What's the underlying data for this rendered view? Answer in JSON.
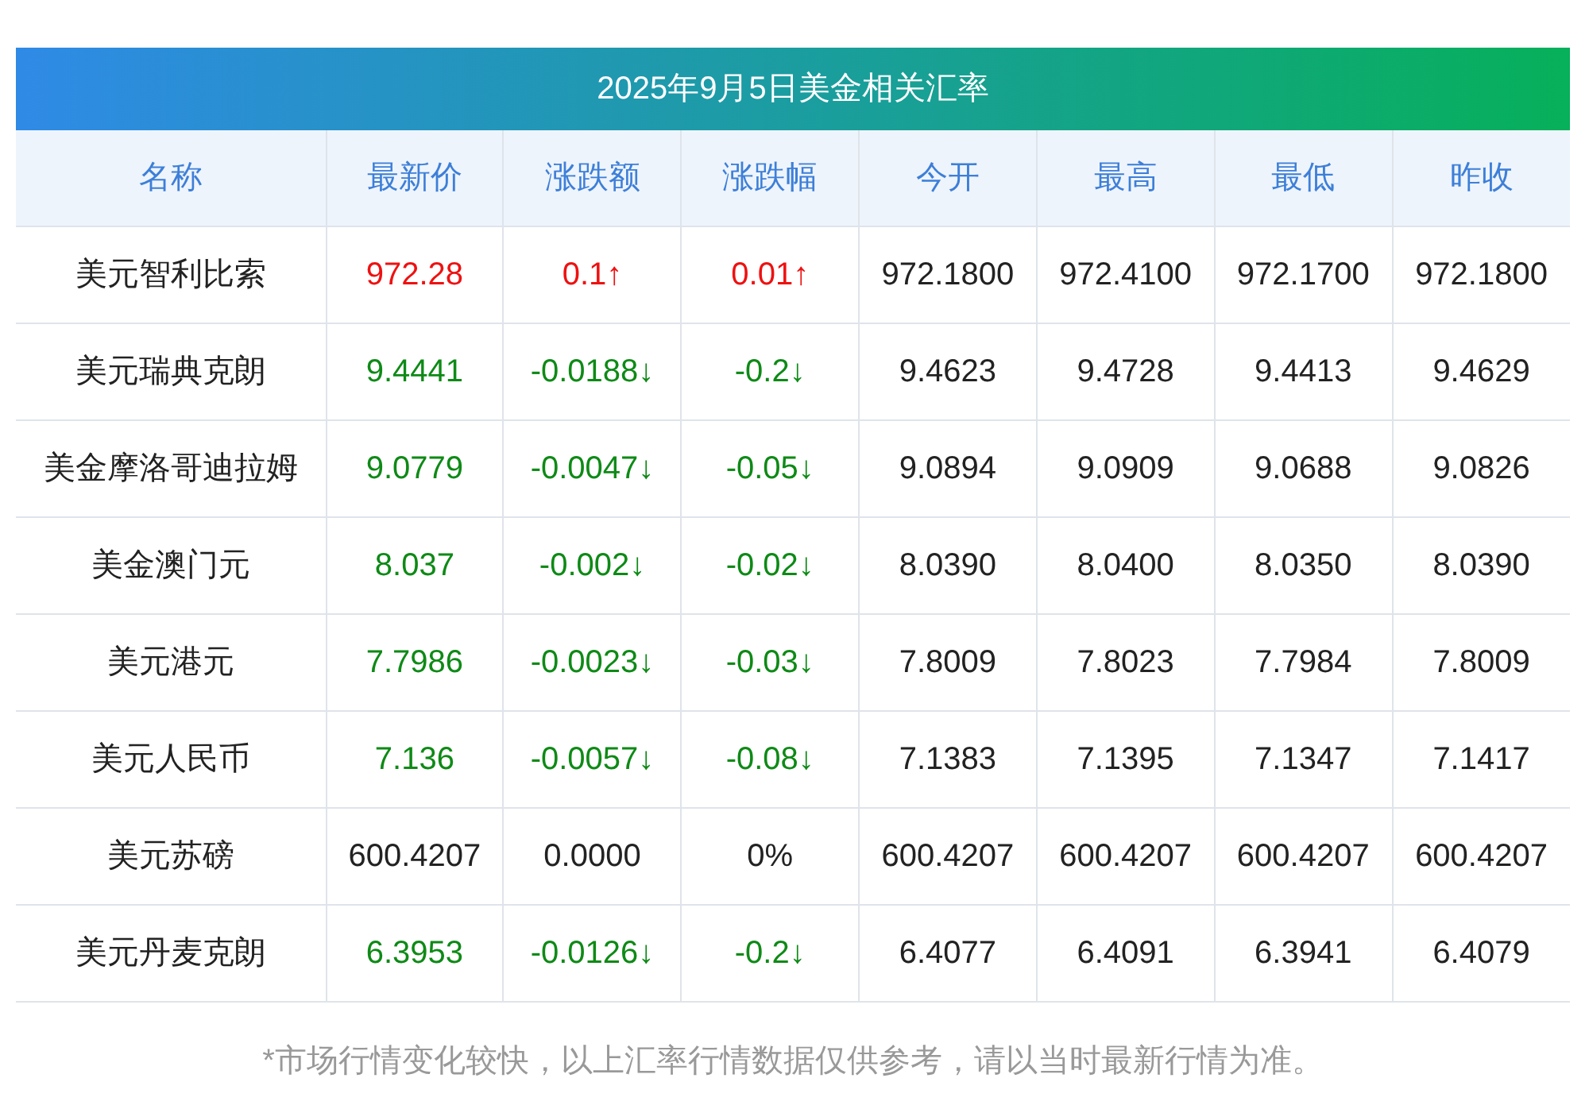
{
  "title": "2025年9月5日美金相关汇率",
  "columns": [
    "名称",
    "最新价",
    "涨跌额",
    "涨跌幅",
    "今开",
    "最高",
    "最低",
    "昨收"
  ],
  "rows": [
    {
      "name": "美元智利比索",
      "kind": "up",
      "latest": "972.28",
      "change": "0.1↑",
      "change_pct": "0.01↑",
      "open": "972.1800",
      "high": "972.4100",
      "low": "972.1700",
      "prev_close": "972.1800"
    },
    {
      "name": "美元瑞典克朗",
      "kind": "down",
      "latest": "9.4441",
      "change": "-0.0188↓",
      "change_pct": "-0.2↓",
      "open": "9.4623",
      "high": "9.4728",
      "low": "9.4413",
      "prev_close": "9.4629"
    },
    {
      "name": "美金摩洛哥迪拉姆",
      "kind": "down",
      "latest": "9.0779",
      "change": "-0.0047↓",
      "change_pct": "-0.05↓",
      "open": "9.0894",
      "high": "9.0909",
      "low": "9.0688",
      "prev_close": "9.0826"
    },
    {
      "name": "美金澳门元",
      "kind": "down",
      "latest": "8.037",
      "change": "-0.002↓",
      "change_pct": "-0.02↓",
      "open": "8.0390",
      "high": "8.0400",
      "low": "8.0350",
      "prev_close": "8.0390"
    },
    {
      "name": "美元港元",
      "kind": "down",
      "latest": "7.7986",
      "change": "-0.0023↓",
      "change_pct": "-0.03↓",
      "open": "7.8009",
      "high": "7.8023",
      "low": "7.7984",
      "prev_close": "7.8009"
    },
    {
      "name": "美元人民币",
      "kind": "down",
      "latest": "7.136",
      "change": "-0.0057↓",
      "change_pct": "-0.08↓",
      "open": "7.1383",
      "high": "7.1395",
      "low": "7.1347",
      "prev_close": "7.1417"
    },
    {
      "name": "美元苏磅",
      "kind": "flat",
      "latest": "600.4207",
      "change": "0.0000",
      "change_pct": "0%",
      "open": "600.4207",
      "high": "600.4207",
      "low": "600.4207",
      "prev_close": "600.4207"
    },
    {
      "name": "美元丹麦克朗",
      "kind": "down",
      "latest": "6.3953",
      "change": "-0.0126↓",
      "change_pct": "-0.2↓",
      "open": "6.4077",
      "high": "6.4091",
      "low": "6.3941",
      "prev_close": "6.4079"
    }
  ],
  "footnote": "*市场行情变化较快，以上汇率行情数据仅供参考，请以当时最新行情为准。"
}
